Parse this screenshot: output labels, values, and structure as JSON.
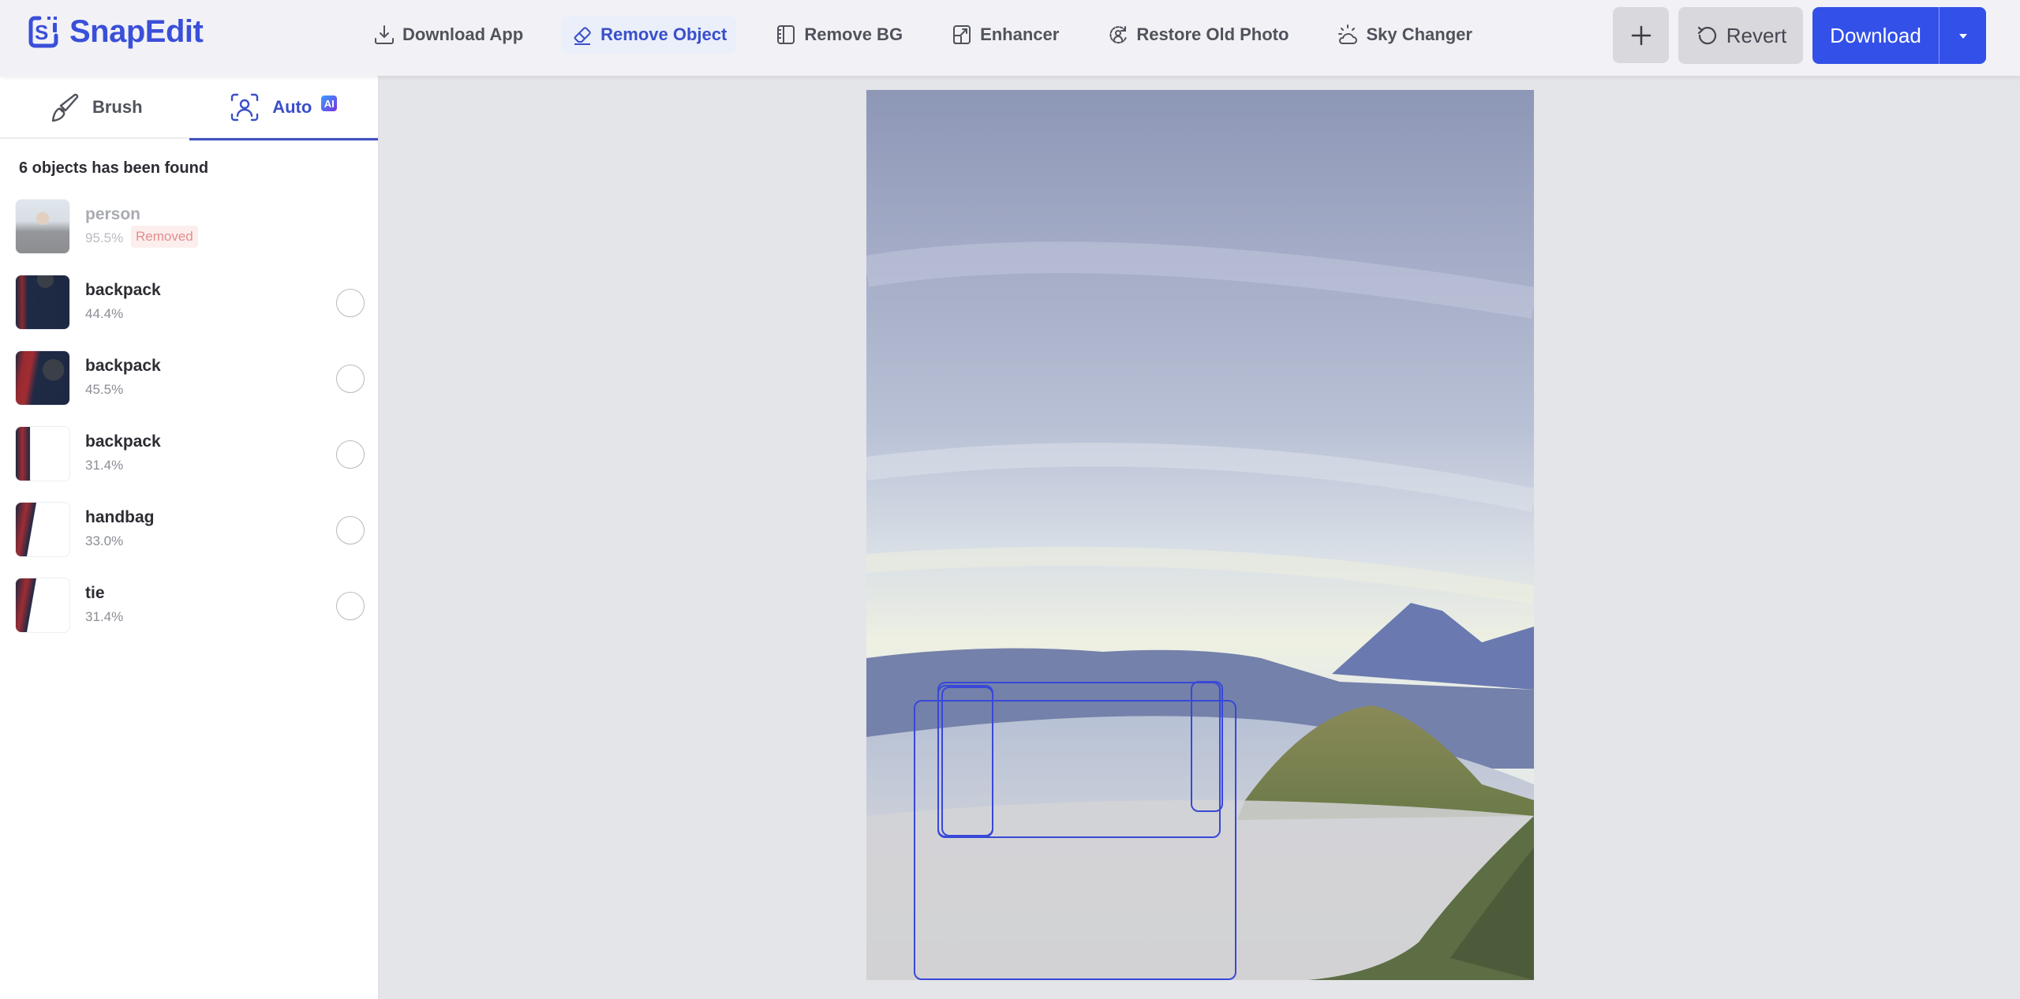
{
  "app": {
    "name": "SnapEdit",
    "brand_color": "#3a4fd9",
    "accent_color": "#3350e8"
  },
  "nav": {
    "items": [
      {
        "label": "Download App",
        "icon": "download-icon",
        "active": false
      },
      {
        "label": "Remove Object",
        "icon": "eraser-icon",
        "active": true
      },
      {
        "label": "Remove BG",
        "icon": "remove-bg-icon",
        "active": false
      },
      {
        "label": "Enhancer",
        "icon": "enhance-icon",
        "active": false
      },
      {
        "label": "Restore Old Photo",
        "icon": "restore-face-icon",
        "active": false
      },
      {
        "label": "Sky Changer",
        "icon": "sun-cloud-icon",
        "active": false
      }
    ]
  },
  "toolbar": {
    "add_icon": "plus-icon",
    "revert_label": "Revert",
    "download_label": "Download",
    "dropdown_icon": "caret-down-icon"
  },
  "sidebar": {
    "tabs": [
      {
        "label": "Brush",
        "icon": "brush-icon",
        "active": false
      },
      {
        "label": "Auto",
        "icon": "face-scan-icon",
        "badge": "AI",
        "active": true
      }
    ],
    "found_title": "6 objects has been found",
    "objects": [
      {
        "name": "person",
        "score": "95.5%",
        "status": "Removed",
        "removed": true
      },
      {
        "name": "backpack",
        "score": "44.4%",
        "removed": false,
        "selected": false
      },
      {
        "name": "backpack",
        "score": "45.5%",
        "removed": false,
        "selected": false
      },
      {
        "name": "backpack",
        "score": "31.4%",
        "removed": false,
        "selected": false
      },
      {
        "name": "handbag",
        "score": "33.0%",
        "removed": false,
        "selected": false
      },
      {
        "name": "tie",
        "score": "31.4%",
        "removed": false,
        "selected": false
      }
    ]
  },
  "canvas": {
    "image_description": "Mountain volcano landscape with sea of clouds",
    "detection_box_color": "#3848d8"
  }
}
